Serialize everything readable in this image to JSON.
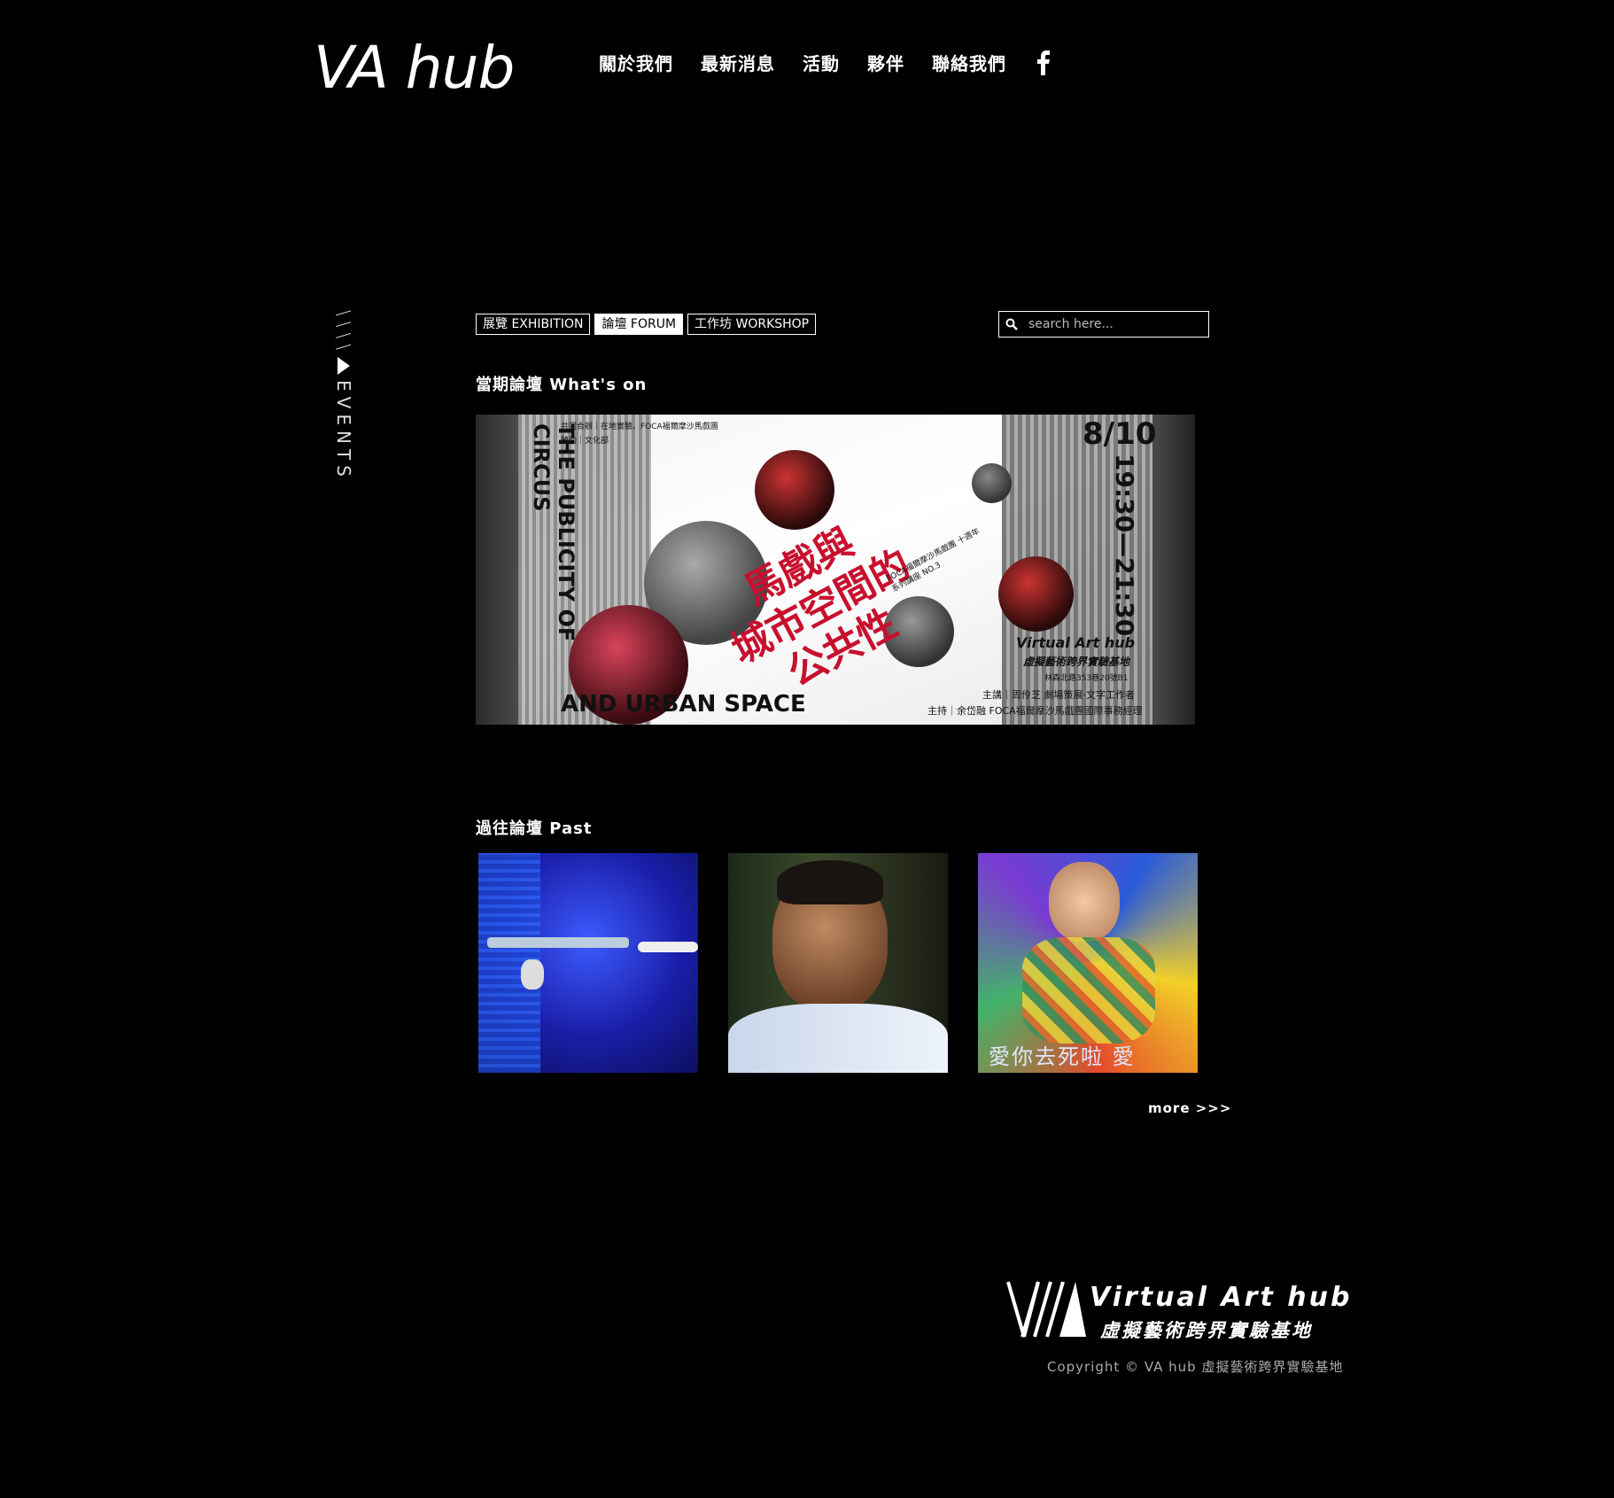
{
  "header": {
    "logo": "VA hub",
    "nav": [
      "關於我們",
      "最新消息",
      "活動",
      "夥伴",
      "聯絡我們"
    ]
  },
  "side": {
    "slashes": "\\\\\\\\",
    "label": "EVENTS"
  },
  "filters": [
    {
      "label": "展覽 EXHIBITION",
      "active": false
    },
    {
      "label": "論壇 FORUM",
      "active": true
    },
    {
      "label": "工作坊 WORKSHOP",
      "active": false
    }
  ],
  "search": {
    "placeholder": "search here..."
  },
  "sections": {
    "now": "當期論壇 What's on",
    "past": "過往論壇 Past"
  },
  "banner": {
    "title_en_vertical": "THE PUBLICITY OF CIRCUS",
    "title_en_bottom": "AND URBAN SPACE",
    "title_zh": [
      "馬戲與",
      "城市空間的",
      "公共性"
    ],
    "date": "8/10",
    "time": "19:30—21:30",
    "series": "FOCA福爾摩沙馬戲團 十週年系列講座 NO.3",
    "cohost": "共同合辦｜在地實驗、FOCA福爾摩沙馬戲團",
    "sponsor": "贊助｜文化部",
    "venue_en": "Virtual Art hub",
    "venue_zh": "虛擬藝術跨界實驗基地",
    "address": "林森北路353巷20號B1",
    "speaker": "主講｜周伶芝 劇場策展·文字工作者",
    "host": "主持｜余岱融 FOCA福爾摩沙馬戲團國際事務經理"
  },
  "past_thumbs": [
    {
      "name": "robotic-hands"
    },
    {
      "name": "man-smoking"
    },
    {
      "name": "colorful-portrait",
      "caption": "愛你去死啦 愛"
    }
  ],
  "more": "more >>>",
  "footer": {
    "brand": "Virtual Art hub",
    "sub": "虛擬藝術跨界實驗基地",
    "copyright": "Copyright © VA hub 虛擬藝術跨界實驗基地"
  }
}
